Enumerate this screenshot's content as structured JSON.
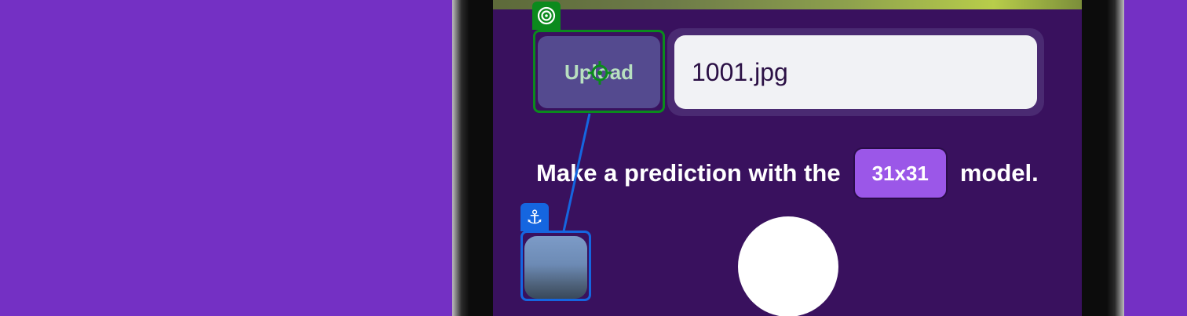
{
  "upload": {
    "label": "Upload"
  },
  "file": {
    "value": "1001.jpg"
  },
  "prediction": {
    "prefix": "Make a prediction with the",
    "model": "31x31",
    "suffix": "model."
  },
  "overlay": {
    "anchor_icon": "⚓",
    "target_icon": "target-icon",
    "target_color": "#0b8a1d",
    "anchor_color": "#1566e0"
  },
  "colors": {
    "background": "#7430c4",
    "screen": "#39115e",
    "upload_button": "#544a8f",
    "model_pill": "#9b57e8"
  }
}
